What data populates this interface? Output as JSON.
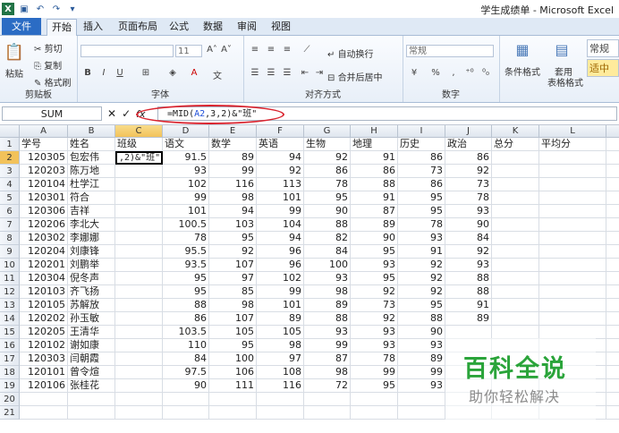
{
  "window": {
    "title": "学生成绩单 - Microsoft Excel"
  },
  "tabs": [
    "文件",
    "开始",
    "插入",
    "页面布局",
    "公式",
    "数据",
    "审阅",
    "视图"
  ],
  "ribbon": {
    "clipboard": {
      "paste": "粘贴",
      "cut": "剪切",
      "copy": "复制",
      "format_painter": "格式刷",
      "label": "剪贴板"
    },
    "font": {
      "size": "11",
      "bold": "B",
      "italic": "I",
      "underline": "U",
      "label": "字体"
    },
    "alignment": {
      "wrap": "自动换行",
      "merge": "合并后居中",
      "label": "对齐方式"
    },
    "number": {
      "format": "常规",
      "label": "数字"
    },
    "styles": {
      "conditional": "条件格式",
      "table": "套用",
      "table2": "表格格式",
      "style_normal": "常规",
      "style_medium": "适中"
    }
  },
  "formula_bar": {
    "name_box": "SUM",
    "fx": "fx",
    "formula_prefix": "=MID(",
    "formula_ref": "A2",
    "formula_suffix": ",3,2)&\"班\""
  },
  "columns": [
    "A",
    "B",
    "C",
    "D",
    "E",
    "F",
    "G",
    "H",
    "I",
    "J",
    "K",
    "L",
    "M"
  ],
  "rows": [
    [
      "学号",
      "姓名",
      "班级",
      "语文",
      "数学",
      "英语",
      "生物",
      "地理",
      "历史",
      "政治",
      "总分",
      "平均分",
      ""
    ],
    [
      "120305",
      "包宏伟",
      ",2)&\"班\"",
      "91.5",
      "89",
      "94",
      "92",
      "91",
      "86",
      "86",
      "",
      "",
      ""
    ],
    [
      "120203",
      "陈万地",
      "",
      "93",
      "99",
      "92",
      "86",
      "86",
      "73",
      "92",
      "",
      "",
      ""
    ],
    [
      "120104",
      "杜学江",
      "",
      "102",
      "116",
      "113",
      "78",
      "88",
      "86",
      "73",
      "",
      "",
      ""
    ],
    [
      "120301",
      "符合",
      "",
      "99",
      "98",
      "101",
      "95",
      "91",
      "95",
      "78",
      "",
      "",
      ""
    ],
    [
      "120306",
      "吉祥",
      "",
      "101",
      "94",
      "99",
      "90",
      "87",
      "95",
      "93",
      "",
      "",
      ""
    ],
    [
      "120206",
      "李北大",
      "",
      "100.5",
      "103",
      "104",
      "88",
      "89",
      "78",
      "90",
      "",
      "",
      ""
    ],
    [
      "120302",
      "李娜娜",
      "",
      "78",
      "95",
      "94",
      "82",
      "90",
      "93",
      "84",
      "",
      "",
      ""
    ],
    [
      "120204",
      "刘康锋",
      "",
      "95.5",
      "92",
      "96",
      "84",
      "95",
      "91",
      "92",
      "",
      "",
      ""
    ],
    [
      "120201",
      "刘鹏举",
      "",
      "93.5",
      "107",
      "96",
      "100",
      "93",
      "92",
      "93",
      "",
      "",
      ""
    ],
    [
      "120304",
      "倪冬声",
      "",
      "95",
      "97",
      "102",
      "93",
      "95",
      "92",
      "88",
      "",
      "",
      ""
    ],
    [
      "120103",
      "齐飞扬",
      "",
      "95",
      "85",
      "99",
      "98",
      "92",
      "92",
      "88",
      "",
      "",
      ""
    ],
    [
      "120105",
      "苏解放",
      "",
      "88",
      "98",
      "101",
      "89",
      "73",
      "95",
      "91",
      "",
      "",
      ""
    ],
    [
      "120202",
      "孙玉敏",
      "",
      "86",
      "107",
      "89",
      "88",
      "92",
      "88",
      "89",
      "",
      "",
      ""
    ],
    [
      "120205",
      "王清华",
      "",
      "103.5",
      "105",
      "105",
      "93",
      "93",
      "90",
      "",
      "",
      "",
      ""
    ],
    [
      "120102",
      "谢如康",
      "",
      "110",
      "95",
      "98",
      "99",
      "93",
      "93",
      "",
      "",
      "",
      ""
    ],
    [
      "120303",
      "闫朝霞",
      "",
      "84",
      "100",
      "97",
      "87",
      "78",
      "89",
      "",
      "",
      "",
      ""
    ],
    [
      "120101",
      "曾令煊",
      "",
      "97.5",
      "106",
      "108",
      "98",
      "99",
      "99",
      "",
      "",
      "",
      ""
    ],
    [
      "120106",
      "张桂花",
      "",
      "90",
      "111",
      "116",
      "72",
      "95",
      "93",
      "",
      "",
      "",
      ""
    ],
    [
      "",
      "",
      "",
      "",
      "",
      "",
      "",
      "",
      "",
      "",
      "",
      "",
      ""
    ],
    [
      "",
      "",
      "",
      "",
      "",
      "",
      "",
      "",
      "",
      "",
      "",
      "",
      ""
    ]
  ],
  "watermark": {
    "line1": "百科全说",
    "line2": "助你轻松解决"
  }
}
